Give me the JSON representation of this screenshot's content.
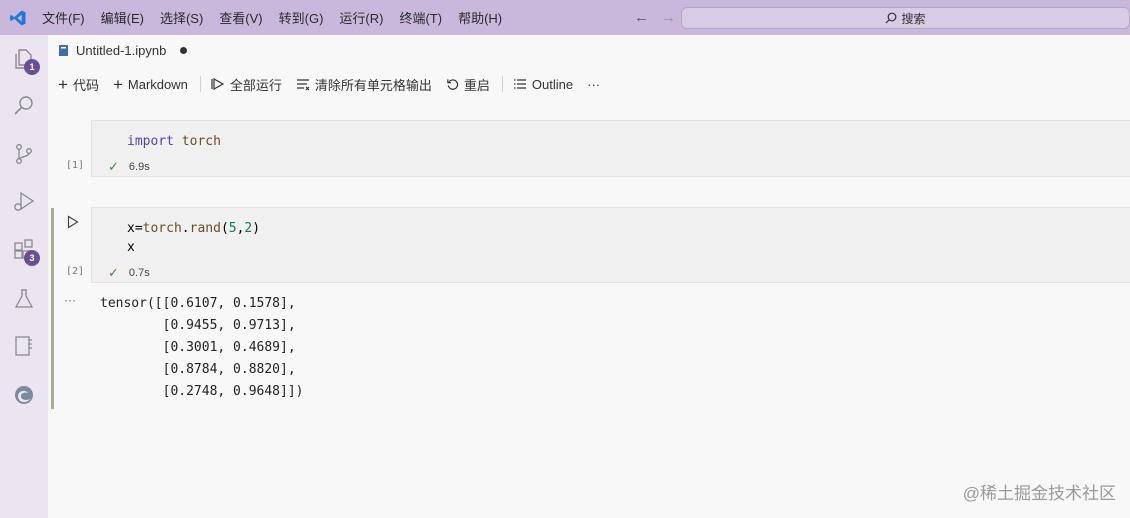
{
  "menu": [
    "文件(F)",
    "编辑(E)",
    "选择(S)",
    "查看(V)",
    "转到(G)",
    "运行(R)",
    "终端(T)",
    "帮助(H)"
  ],
  "search": {
    "label": "搜索"
  },
  "activity_badges": {
    "explorer": "1",
    "extensions": "3"
  },
  "tab": {
    "title": "Untitled-1.ipynb"
  },
  "toolbar": {
    "code": "代码",
    "markdown": "Markdown",
    "run_all": "全部运行",
    "clear_outputs": "清除所有单元格输出",
    "restart": "重启",
    "outline": "Outline",
    "more": "···"
  },
  "cells": [
    {
      "exec": "[1]",
      "time": "6.9s"
    },
    {
      "exec": "[2]",
      "time": "0.7s"
    }
  ],
  "output": {
    "ellipsis": "···",
    "lines": [
      "tensor([[0.6107, 0.1578],",
      "        [0.9455, 0.9713],",
      "        [0.3001, 0.4689],",
      "        [0.8784, 0.8820],",
      "        [0.2748, 0.9648]])"
    ]
  },
  "watermark": "@稀土掘金技术社区",
  "colors": {
    "titlebar": "#c9b7dc",
    "activity_bar": "#ebe5f2",
    "badge": "#6a4f95",
    "check": "#3c8a3c"
  }
}
